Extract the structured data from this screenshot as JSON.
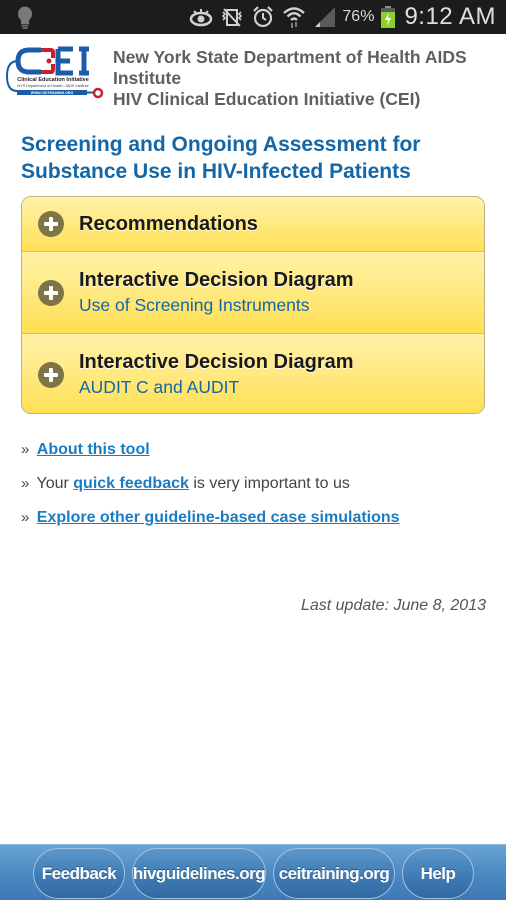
{
  "status_bar": {
    "icons": [
      "lightbulb-icon",
      "eye-icon",
      "vibrate-mute-icon",
      "alarm-icon",
      "wifi-icon",
      "signal-icon",
      "battery-charging-icon"
    ],
    "battery_percent": "76%",
    "time": "9:12 AM",
    "battery_color": "#8bd129"
  },
  "header": {
    "logo": {
      "text": "CEI",
      "subtitle": "Clinical Education Initiative",
      "line2": "NYS Department of Health • AIDS Institute",
      "url": "WWW.CEITRAINING.ORG"
    },
    "org_line1": "New York State Department of Health AIDS Institute",
    "org_line2": "HIV Clinical Education Initiative (CEI)"
  },
  "page": {
    "title": "Screening and Ongoing Assessment for Substance Use in HIV-Infected Patients"
  },
  "accordion": [
    {
      "title": "Recommendations",
      "subtitle": ""
    },
    {
      "title": "Interactive Decision Diagram",
      "subtitle": "Use of Screening Instruments"
    },
    {
      "title": "Interactive Decision Diagram",
      "subtitle": "AUDIT C and AUDIT"
    }
  ],
  "links": {
    "bullet": "»",
    "about": "About this tool",
    "feedback_prefix": "Your",
    "feedback_link": "quick feedback",
    "feedback_suffix": "is very important to us",
    "explore": "Explore other guideline-based case simulations"
  },
  "last_update": "Last update: June 8, 2013",
  "bottom_nav": [
    {
      "label": "Feedback"
    },
    {
      "label": "hivguidelines.org"
    },
    {
      "label": "ceitraining.org"
    },
    {
      "label": "Help"
    }
  ],
  "colors": {
    "title_blue": "#1467a6",
    "link_blue": "#1a7dc4",
    "accordion_yellow": "#ffe46a",
    "bottom_bar_blue": "#4f8cc4"
  }
}
